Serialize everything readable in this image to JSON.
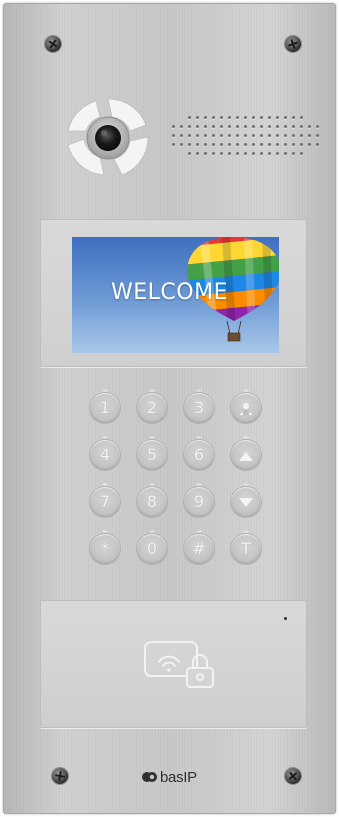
{
  "device": {
    "screen": {
      "text": "WELCOME"
    },
    "keypad": {
      "keys": [
        {
          "label": "1"
        },
        {
          "label": "2"
        },
        {
          "label": "3"
        },
        {
          "label": "",
          "icon": "contacts-icon"
        },
        {
          "label": "4"
        },
        {
          "label": "5"
        },
        {
          "label": "6"
        },
        {
          "label": "",
          "icon": "arrow-up-icon"
        },
        {
          "label": "7"
        },
        {
          "label": "8"
        },
        {
          "label": "9"
        },
        {
          "label": "",
          "icon": "arrow-down-icon"
        },
        {
          "label": "*"
        },
        {
          "label": "0"
        },
        {
          "label": "#"
        },
        {
          "label": "T"
        }
      ]
    },
    "rfid": {
      "icon": "rfid-card-lock-icon"
    },
    "brand": {
      "logo_text": "basIP"
    }
  },
  "colors": {
    "panel": "#c8c8c8",
    "screen_sky": "#5a8bd0",
    "key_text": "#f4f4f4"
  }
}
